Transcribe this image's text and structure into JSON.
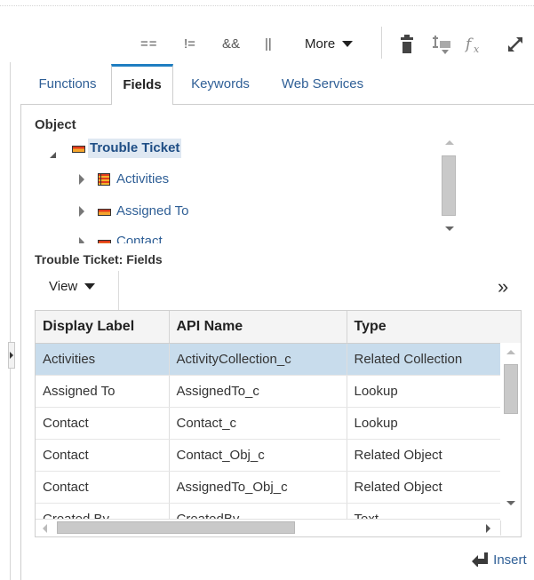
{
  "toolbar": {
    "equals": "==",
    "not_equals": "!=",
    "and": "&&",
    "or": "||",
    "more_label": "More",
    "icons": [
      "delete-icon",
      "filter-icon",
      "function-icon",
      "expand-icon"
    ]
  },
  "tabs": [
    {
      "label": "Functions",
      "active": false
    },
    {
      "label": "Fields",
      "active": true
    },
    {
      "label": "Keywords",
      "active": false
    },
    {
      "label": "Web Services",
      "active": false
    }
  ],
  "object_section": {
    "label": "Object",
    "root": {
      "label": "Trouble Ticket",
      "expanded": true,
      "selected": true
    },
    "children": [
      {
        "label": "Activities",
        "icon": "collection-icon"
      },
      {
        "label": "Assigned To",
        "icon": "object-icon"
      },
      {
        "label": "Contact",
        "icon": "object-icon"
      }
    ]
  },
  "fields_section": {
    "title": "Trouble Ticket: Fields",
    "view_label": "View",
    "more_glyph": "»",
    "columns": [
      "Display Label",
      "API Name",
      "Type"
    ],
    "rows": [
      {
        "display": "Activities",
        "api": "ActivityCollection_c",
        "type": "Related Collection",
        "selected": true
      },
      {
        "display": "Assigned To",
        "api": "AssignedTo_c",
        "type": "Lookup",
        "selected": false
      },
      {
        "display": "Contact",
        "api": "Contact_c",
        "type": "Lookup",
        "selected": false
      },
      {
        "display": "Contact",
        "api": "Contact_Obj_c",
        "type": "Related Object",
        "selected": false
      },
      {
        "display": "Contact",
        "api": "AssignedTo_Obj_c",
        "type": "Related Object",
        "selected": false
      },
      {
        "display": "Created By",
        "api": "CreatedBy",
        "type": "Text",
        "selected": false
      }
    ]
  },
  "insert_label": "Insert",
  "colors": {
    "link": "#2f5f96",
    "active_tab_accent": "#1f7ec1",
    "selected_row": "#c8dcec",
    "header_bg": "#f4f4f4"
  }
}
